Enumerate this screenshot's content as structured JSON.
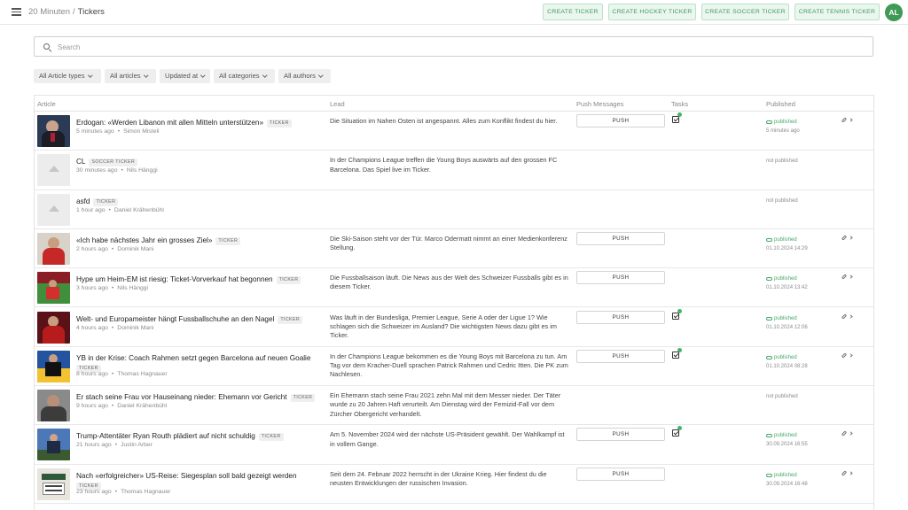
{
  "header": {
    "app_name": "20 Minuten",
    "separator": "/",
    "section": "Tickers",
    "buttons": [
      {
        "label": "CREATE TICKER"
      },
      {
        "label": "CREATE HOCKEY TICKER"
      },
      {
        "label": "CREATE SOCCER TICKER"
      },
      {
        "label": "CREATE TENNIS TICKER"
      }
    ],
    "avatar_initials": "AL"
  },
  "search": {
    "placeholder": "Search"
  },
  "filters": [
    {
      "label": "All Article types"
    },
    {
      "label": "All articles"
    },
    {
      "label": "Updated at"
    },
    {
      "label": "All categories"
    },
    {
      "label": "All authors"
    }
  ],
  "table": {
    "columns": {
      "article": "Article",
      "lead": "Lead",
      "push": "Push Messages",
      "tasks": "Tasks",
      "published": "Published"
    },
    "push_label": "PUSH",
    "rows": [
      {
        "title": "Erdogan: «Werden Libanon mit allen Mitteln unterstützen»",
        "badge": "TICKER",
        "time": "5 minutes ago",
        "author": "Simon Misteli",
        "lead": "Die Situation im Nahen Osten ist angespannt. Alles zum Konflikt findest du hier.",
        "push": true,
        "task": true,
        "published": true,
        "status": "published",
        "date": "5 minutes ago"
      },
      {
        "title": "CL",
        "badge": "SOCCER TICKER",
        "time": "30 minutes ago",
        "author": "Nils Hänggi",
        "lead": "In der Champions League treffen die Young Boys auswärts auf den grossen FC Barcelona. Das Spiel live im Ticker.",
        "push": false,
        "task": false,
        "published": false,
        "status": "not published",
        "date": ""
      },
      {
        "title": "asfd",
        "badge": "TICKER",
        "time": "1 hour ago",
        "author": "Daniel Krähenbühl",
        "lead": "",
        "push": false,
        "task": false,
        "published": false,
        "status": "not published",
        "date": ""
      },
      {
        "title": "«Ich habe nächstes Jahr ein grosses Ziel»",
        "badge": "TICKER",
        "time": "2 hours ago",
        "author": "Dominik Mani",
        "lead": "Die Ski-Saison steht vor der Tür. Marco Odermatt nimmt an einer Medienkonferenz Stellung.",
        "push": true,
        "task": false,
        "published": true,
        "status": "published",
        "date": "01.10.2024 14:29"
      },
      {
        "title": "Hype um Heim-EM ist riesig: Ticket-Vorverkauf hat begonnen",
        "badge": "TICKER",
        "time": "3 hours ago",
        "author": "Nils Hänggi",
        "lead": "Die Fussballsaison läuft. Die News aus der Welt des Schweizer Fussballs gibt es in diesem Ticker.",
        "push": true,
        "task": false,
        "published": true,
        "status": "published",
        "date": "01.10.2024 13:42"
      },
      {
        "title": "Welt- und Europameister hängt Fussballschuhe an den Nagel",
        "badge": "TICKER",
        "time": "4 hours ago",
        "author": "Dominik Mani",
        "lead": "Was läuft in der Bundesliga, Premier League, Serie A oder der Ligue 1? Wie schlagen sich die Schweizer im Ausland? Die wichtigsten News dazu gibt es im Ticker.",
        "push": true,
        "task": true,
        "published": true,
        "status": "published",
        "date": "01.10.2024 12:06"
      },
      {
        "title": "YB in der Krise: Coach Rahmen setzt gegen Barcelona auf neuen Goalie",
        "badge": "TICKER",
        "time": "8 hours ago",
        "author": "Thomas Hagnauer",
        "lead": "In der Champions League bekommen es die Young Boys mit Barcelona zu tun. Am Tag vor dem Kracher-Duell sprachen Patrick Rahmen und Cedric Itten. Die PK zum Nachlesen.",
        "push": true,
        "task": true,
        "published": true,
        "status": "published",
        "date": "01.10.2024 08:28"
      },
      {
        "title": "Er stach seine Frau vor Hauseinang nieder: Ehemann vor Gericht",
        "badge": "TICKER",
        "time": "9 hours ago",
        "author": "Daniel Krähenbühl",
        "lead": "Ein Ehemann stach seine Frau 2021 zehn Mal mit dem Messer nieder. Der Täter wurde zu 20 Jahren Haft verurteilt. Am Dienstag wird der Femizid-Fall vor dem Zürcher Obergericht verhandelt.",
        "push": false,
        "task": false,
        "published": false,
        "status": "not published",
        "date": ""
      },
      {
        "title": "Trump-Attentäter Ryan Routh plädiert auf nicht schuldig",
        "badge": "TICKER",
        "time": "21 hours ago",
        "author": "Justin Arber",
        "lead": "Am 5. November 2024 wird der nächste US-Präsident gewählt. Der Wahlkampf ist in vollem Gange.",
        "push": true,
        "task": true,
        "published": true,
        "status": "published",
        "date": "30.09.2024 16:55"
      },
      {
        "title": "Nach «erfolgreicher» US-Reise: Siegesplan soll bald gezeigt werden",
        "badge": "TICKER",
        "time": "23 hours ago",
        "author": "Thomas Hagnauer",
        "lead": "Seit dem 24. Februar 2022 herrscht in der Ukraine Krieg. Hier findest du die neusten Entwicklungen der russischen Invasion.",
        "push": true,
        "task": false,
        "published": true,
        "status": "published",
        "date": "30.09.2024 16:48"
      }
    ]
  }
}
